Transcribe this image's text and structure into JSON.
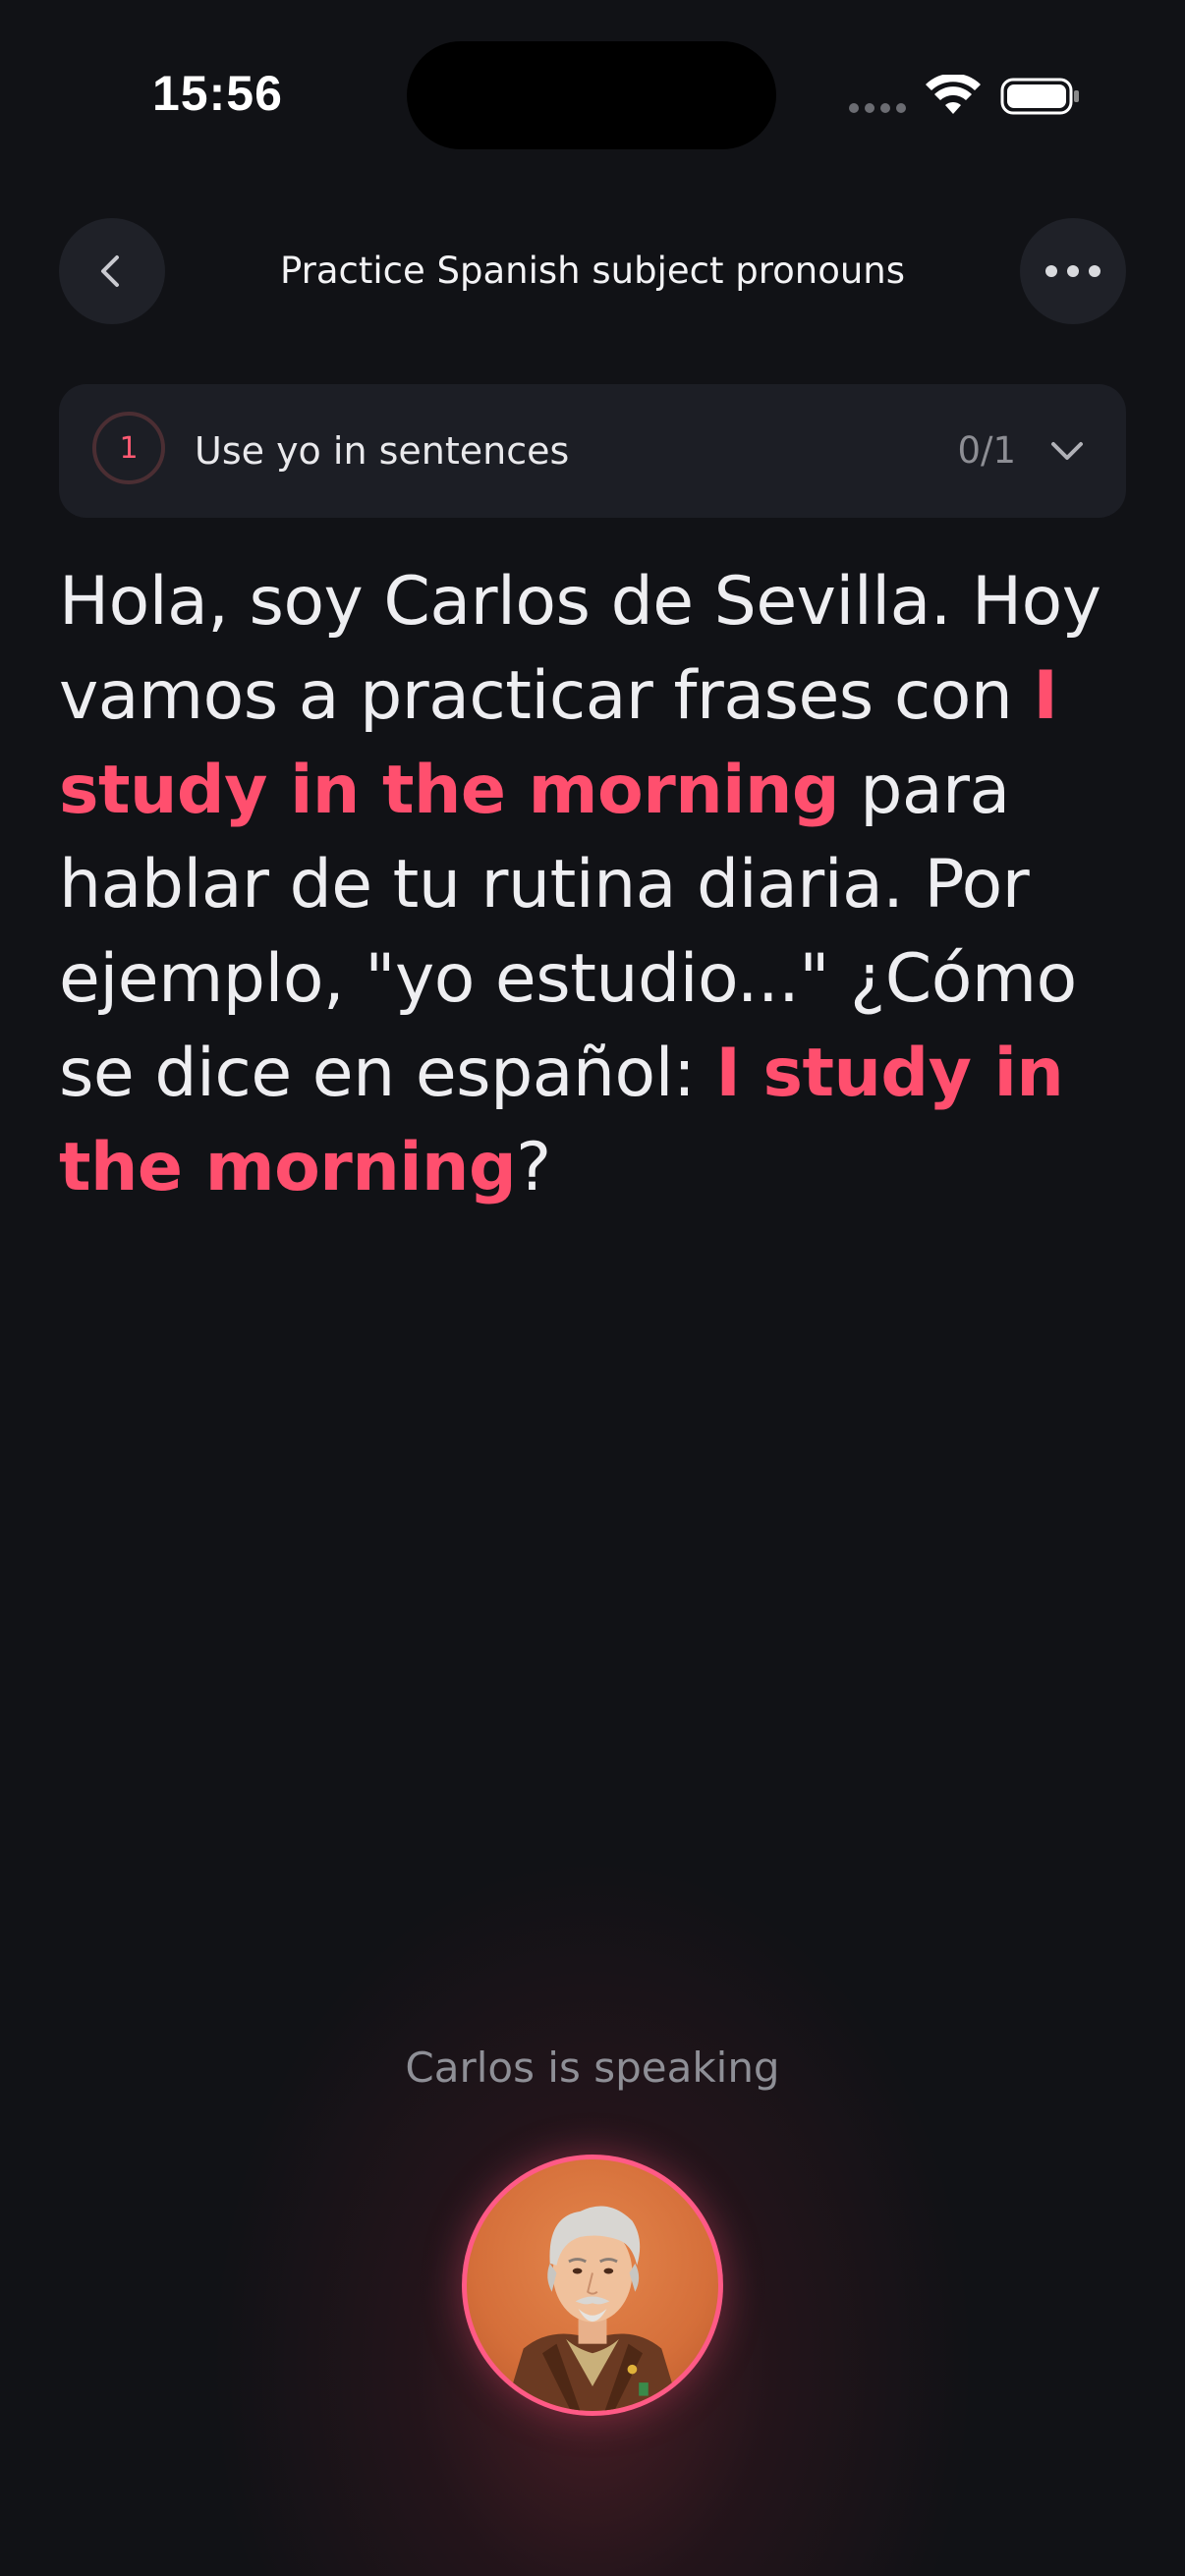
{
  "status_bar": {
    "time": "15:56"
  },
  "header": {
    "title": "Practice Spanish subject pronouns",
    "back_icon": "chevron-left-icon",
    "more_icon": "ellipsis-icon"
  },
  "task": {
    "number": "1",
    "label": "Use yo in sentences",
    "progress": "0/1"
  },
  "message": {
    "parts": [
      "Hola, soy Carlos de Sevilla. Hoy vamos a practicar frases con ",
      "I study in the morning",
      " para hablar de tu rutina diaria. Por ejemplo, \"yo estudio...\" ¿Cómo se dice en español: ",
      "I study in the morning",
      "?"
    ]
  },
  "speaker": {
    "status": "Carlos is speaking"
  },
  "colors": {
    "background": "#111216",
    "accent": "#ff4f6e",
    "card": "#1c1e25"
  }
}
